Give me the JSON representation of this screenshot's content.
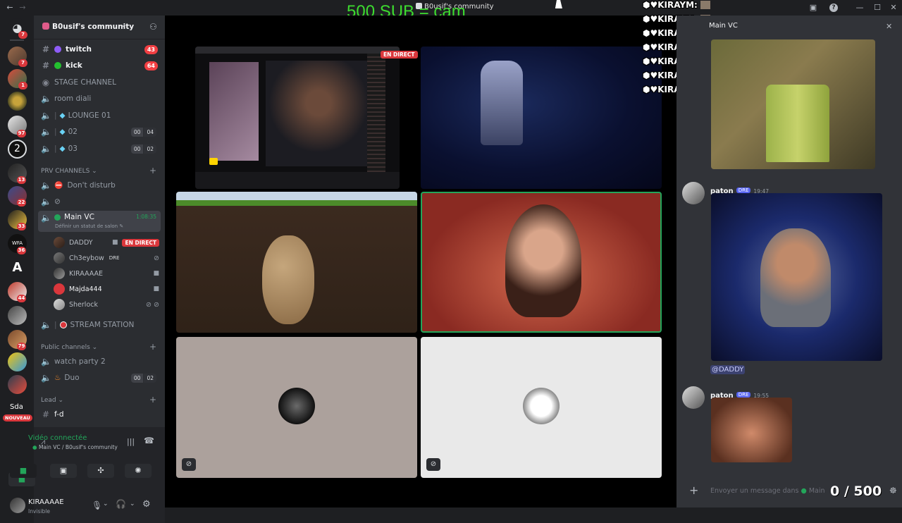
{
  "window": {
    "title": "B0usif's community",
    "overlay_text": "500 SUB = cam"
  },
  "rail": {
    "badges": [
      "7",
      "7",
      "1",
      "",
      "",
      "97",
      "",
      "13",
      "22",
      "33",
      "36",
      "",
      "44",
      "",
      "79",
      "",
      "",
      "",
      "NOUVEAU"
    ],
    "sda_label": "Sda",
    "nouveau_label": "NOUVEAU"
  },
  "guild": {
    "name": "B0usif's community",
    "channels": {
      "twitch": {
        "name": "twitch",
        "badge": "43"
      },
      "kick": {
        "name": "kick",
        "badge": "64"
      },
      "stage": {
        "name": "STAGE CHANNEL"
      },
      "room": {
        "name": "room diali"
      },
      "lounge01": {
        "name": "LOUNGE 01"
      },
      "c02": {
        "name": "02",
        "count_a": "00",
        "count_b": "04"
      },
      "c03": {
        "name": "03",
        "count_a": "00",
        "count_b": "02"
      }
    },
    "prv_category": "PRV CHANNELS",
    "dont_disturb": "Don't disturb",
    "main_vc": {
      "name": "Main VC",
      "timer": "1:08:35",
      "status_hint": "Définir un statut de salon"
    },
    "members": [
      {
        "name": "DADDY",
        "live": "EN DIRECT"
      },
      {
        "name": "Ch3eybow",
        "tag": "DRE"
      },
      {
        "name": "KIRAAAAE"
      },
      {
        "name": "Majda444"
      },
      {
        "name": "Sherlock"
      }
    ],
    "stream_station": "STREAM STATION",
    "public_category": "Public channels",
    "watch_party": "watch party 2",
    "duo": {
      "name": "Duo",
      "count_a": "00",
      "count_b": "02"
    },
    "lead_category": "Lead",
    "fd": "f-d"
  },
  "voice": {
    "status": "Vidéo connectée",
    "location": "Main VC / B0usif's community"
  },
  "user": {
    "name": "KIRAAAAE",
    "status": "Invisible"
  },
  "stage": {
    "live_badge": "EN DIRECT"
  },
  "overlay_chat": {
    "lines": [
      "KIRAYM:",
      "KIRAYM:",
      "KIRAYM:",
      "KIRAYM:",
      "KIRAYM:",
      "KIRAYM:",
      "KIRAYM:"
    ]
  },
  "chat": {
    "header": "Main VC",
    "messages": [
      {
        "author": "paton",
        "tag": "DRE",
        "time": "19:47",
        "mention": "@DADDY"
      },
      {
        "author": "paton",
        "tag": "DRE",
        "time": "19:55"
      }
    ],
    "input_placeholder": "Envoyer un message dans",
    "input_channel": "Main",
    "sub_counter": "0 / 500"
  },
  "colors": {
    "accent": "#5865f2",
    "live_red": "#da373c",
    "speaking_green": "#23a55a",
    "overlay_green": "#3ddc2f"
  }
}
